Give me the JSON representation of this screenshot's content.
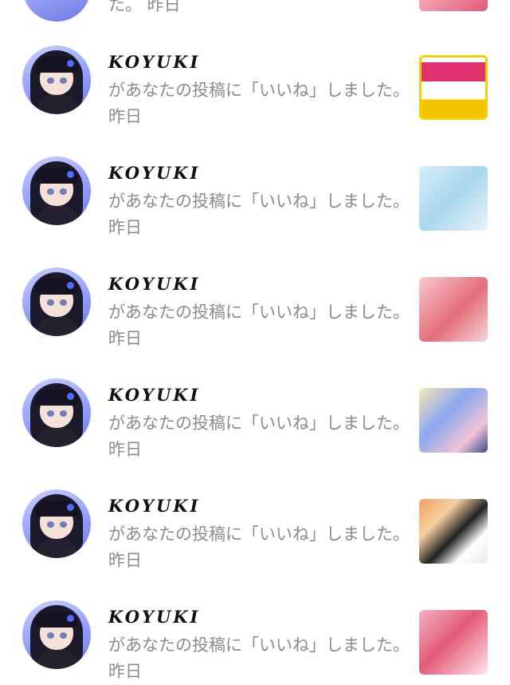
{
  "top_partial": {
    "message": "た。 昨日"
  },
  "items": [
    {
      "username": "KOYUKI",
      "message": "があなたの投稿に「いいね」しました。 昨日"
    },
    {
      "username": "KOYUKI",
      "message": "があなたの投稿に「いいね」しました。 昨日"
    },
    {
      "username": "KOYUKI",
      "message": "があなたの投稿に「いいね」しました。 昨日"
    },
    {
      "username": "KOYUKI",
      "message": "があなたの投稿に「いいね」しました。 昨日"
    },
    {
      "username": "KOYUKI",
      "message": "があなたの投稿に「いいね」しました。 昨日"
    },
    {
      "username": "KOYUKI",
      "message": "があなたの投稿に「いいね」しました。 昨日"
    }
  ]
}
